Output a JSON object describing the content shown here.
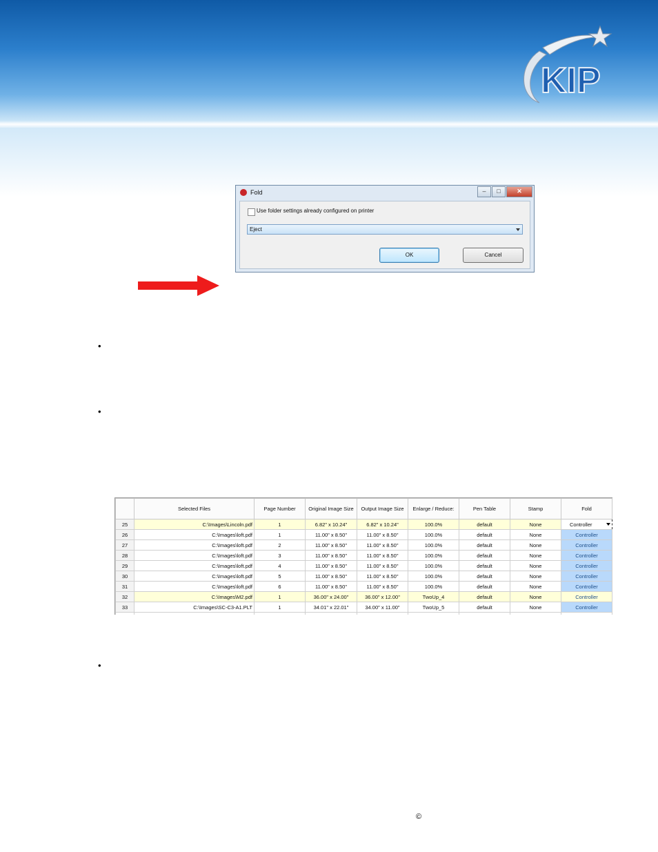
{
  "header": {
    "logo_text": "KIP",
    "colors": {
      "banner_top": "#0f5aa6",
      "banner_mid": "#6fb1e6",
      "logo_blue": "#1f5fb0"
    }
  },
  "dialog": {
    "title": "Fold",
    "checkbox_label": "Use folder settings already configured on printer",
    "checkbox_checked": false,
    "combo_value": "Eject",
    "ok_label": "OK",
    "cancel_label": "Cancel",
    "minimize_glyph": "–",
    "maximize_glyph": "□",
    "close_glyph": "✕"
  },
  "bullets": [
    "•",
    "•",
    "•"
  ],
  "table": {
    "headers": [
      "Selected Files",
      "Page Number",
      "Original Image Size",
      "Output Image Size",
      "Enlarge / Reduce:",
      "Pen Table",
      "Stamp",
      "Fold"
    ],
    "rows": [
      {
        "num": "25",
        "file": "C:\\Images\\Lincoln.pdf",
        "page": "1",
        "orig": "6.82\" x 10.24\"",
        "out": "6.82\" x 10.24\"",
        "scale": "100.0%",
        "pen": "default",
        "stamp": "None",
        "fold": "Controller"
      },
      {
        "num": "26",
        "file": "C:\\Images\\loft.pdf",
        "page": "1",
        "orig": "11.00\" x 8.50\"",
        "out": "11.00\" x 8.50\"",
        "scale": "100.0%",
        "pen": "default",
        "stamp": "None",
        "fold": "Controller"
      },
      {
        "num": "27",
        "file": "C:\\Images\\loft.pdf",
        "page": "2",
        "orig": "11.00\" x 8.50\"",
        "out": "11.00\" x 8.50\"",
        "scale": "100.0%",
        "pen": "default",
        "stamp": "None",
        "fold": "Controller"
      },
      {
        "num": "28",
        "file": "C:\\Images\\loft.pdf",
        "page": "3",
        "orig": "11.00\" x 8.50\"",
        "out": "11.00\" x 8.50\"",
        "scale": "100.0%",
        "pen": "default",
        "stamp": "None",
        "fold": "Controller"
      },
      {
        "num": "29",
        "file": "C:\\Images\\loft.pdf",
        "page": "4",
        "orig": "11.00\" x 8.50\"",
        "out": "11.00\" x 8.50\"",
        "scale": "100.0%",
        "pen": "default",
        "stamp": "None",
        "fold": "Controller"
      },
      {
        "num": "30",
        "file": "C:\\Images\\loft.pdf",
        "page": "5",
        "orig": "11.00\" x 8.50\"",
        "out": "11.00\" x 8.50\"",
        "scale": "100.0%",
        "pen": "default",
        "stamp": "None",
        "fold": "Controller"
      },
      {
        "num": "31",
        "file": "C:\\Images\\loft.pdf",
        "page": "6",
        "orig": "11.00\" x 8.50\"",
        "out": "11.00\" x 8.50\"",
        "scale": "100.0%",
        "pen": "default",
        "stamp": "None",
        "fold": "Controller"
      },
      {
        "num": "32",
        "file": "C:\\Images\\M2.pdf",
        "page": "1",
        "orig": "36.00\" x 24.00\"",
        "out": "36.00\" x 12.00\"",
        "scale": "TwoUp_4",
        "pen": "default",
        "stamp": "None",
        "fold": "Controller"
      },
      {
        "num": "33",
        "file": "C:\\Images\\SC-C3-A1.PLT",
        "page": "1",
        "orig": "34.01\" x 22.01\"",
        "out": "34.00\" x 11.00\"",
        "scale": "TwoUp_5",
        "pen": "default",
        "stamp": "None",
        "fold": "Controller"
      }
    ]
  },
  "footer": {
    "copyright": "©"
  }
}
